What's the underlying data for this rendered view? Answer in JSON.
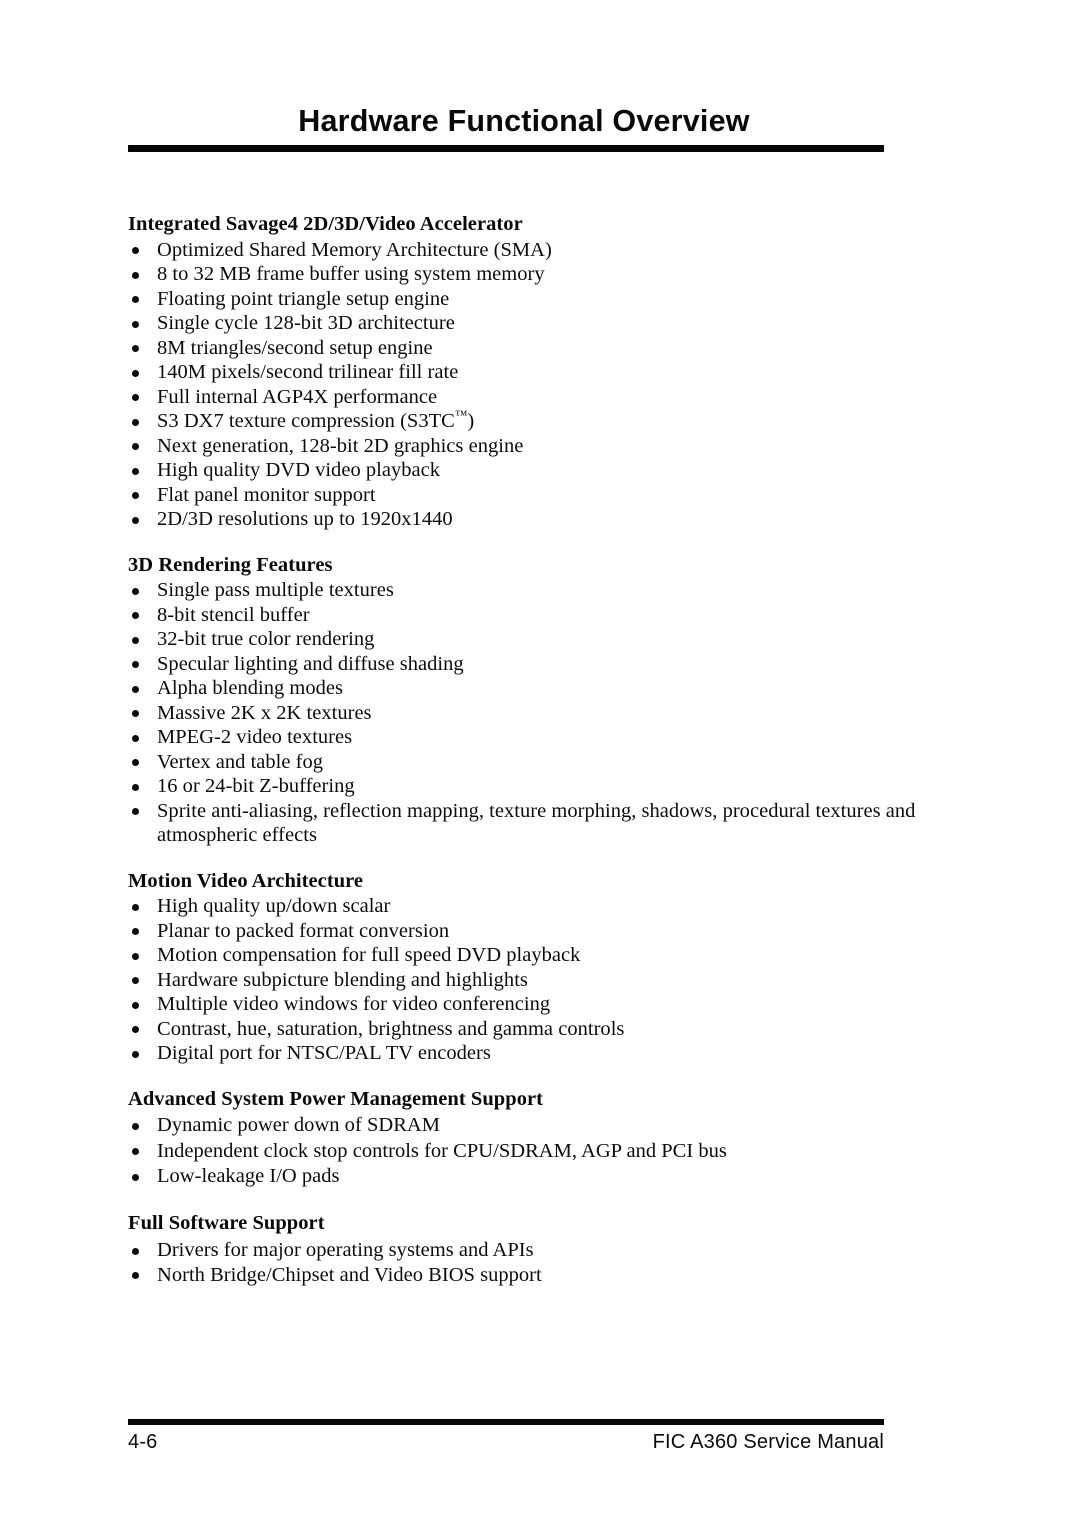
{
  "header": {
    "title": "Hardware Functional Overview"
  },
  "sections": [
    {
      "heading": "Integrated Savage4 2D/3D/Video Accelerator",
      "items": [
        "Optimized Shared Memory Architecture (SMA)",
        "8 to 32 MB frame buffer using system memory",
        "Floating point triangle setup engine",
        "Single cycle 128-bit 3D architecture",
        "8M triangles/second setup engine",
        "140M pixels/second trilinear fill rate",
        "Full internal AGP4X performance",
        "S3 DX7 texture compression (S3TC™)",
        "Next generation, 128-bit 2D graphics engine",
        "High quality DVD video playback",
        "Flat panel monitor support",
        "2D/3D resolutions up to 1920x1440"
      ]
    },
    {
      "heading": "3D Rendering Features",
      "items": [
        "Single pass multiple textures",
        "8-bit stencil buffer",
        "32-bit true color rendering",
        "Specular lighting and diffuse shading",
        "Alpha blending modes",
        "Massive 2K x 2K textures",
        "MPEG-2 video textures",
        "Vertex and table fog",
        "16 or 24-bit Z-buffering",
        "Sprite anti-aliasing, reflection mapping, texture morphing, shadows, procedural textures and atmospheric effects"
      ]
    },
    {
      "heading": "Motion Video Architecture",
      "items": [
        "High quality up/down scalar",
        "Planar to packed format conversion",
        "Motion compensation for full speed DVD playback",
        "Hardware subpicture blending and highlights",
        "Multiple video windows for video conferencing",
        "Contrast, hue, saturation, brightness and gamma controls",
        "Digital port for NTSC/PAL TV encoders"
      ]
    },
    {
      "heading": "Advanced System Power Management Support",
      "items": [
        "Dynamic power down of SDRAM",
        "Independent clock stop controls for CPU/SDRAM, AGP and PCI bus",
        "Low-leakage I/O pads"
      ]
    },
    {
      "heading": "Full Software Support",
      "items": [
        "Drivers for major operating systems and APIs",
        "North Bridge/Chipset and Video BIOS support"
      ]
    }
  ],
  "footer": {
    "page_number": "4-6",
    "manual_name": "FIC A360 Service Manual"
  }
}
